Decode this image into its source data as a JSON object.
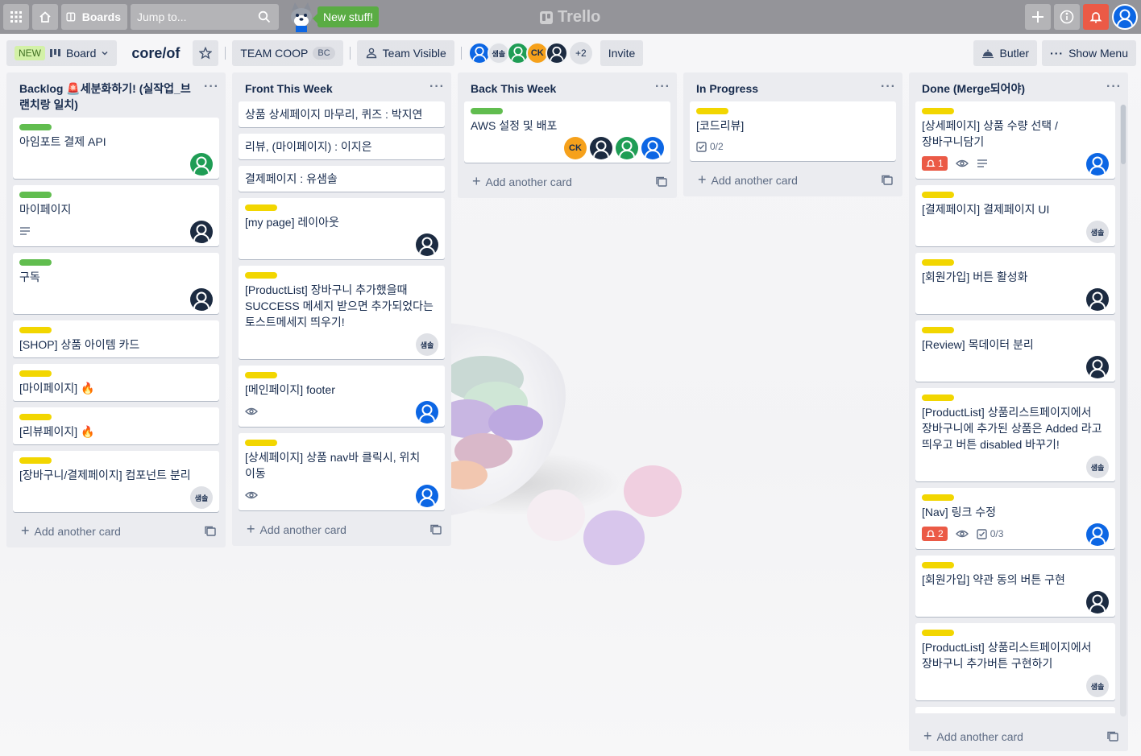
{
  "topbar": {
    "boards_label": "Boards",
    "search_placeholder": "Jump to...",
    "new_stuff_label": "New stuff!",
    "logo_text": "Trello"
  },
  "header": {
    "new_badge": "NEW",
    "view_label": "Board",
    "board_title": "core/of",
    "team_label": "TEAM COOP",
    "team_badge": "BC",
    "visibility_label": "Team Visible",
    "members": [
      "",
      "샘솔",
      "",
      "CK",
      ""
    ],
    "more_members": "+2",
    "invite_label": "Invite",
    "butler_label": "Butler",
    "show_menu_label": "Show Menu"
  },
  "add_card_label": "Add another card",
  "lists": [
    {
      "title": "Backlog 🚨세분화하기! (실작업_브랜치랑 일치)",
      "cards": [
        {
          "label": "green",
          "text": "아임포트 결제 API",
          "members": [
            "green"
          ]
        },
        {
          "label": "green",
          "text": "마이페이지",
          "description": true,
          "members": [
            "dark"
          ]
        },
        {
          "label": "green",
          "text": "구독",
          "members": [
            "dark"
          ]
        },
        {
          "label": "yellow",
          "text": "[SHOP] 상품 아이템 카드"
        },
        {
          "label": "yellow",
          "text": "[마이페이지] 🔥"
        },
        {
          "label": "yellow",
          "text": "[리뷰페이지] 🔥"
        },
        {
          "label": "yellow",
          "text": "[장바구니/결제페이지] 컴포넌트 분리",
          "members": [
            "gray:샘솔"
          ]
        }
      ]
    },
    {
      "title": "Front This Week",
      "cards": [
        {
          "text": "상품 상세페이지 마무리, 퀴즈 : 박지연"
        },
        {
          "text": "리뷰, (마이페이지) : 이지은"
        },
        {
          "text": "결제페이지 : 유샘솔"
        },
        {
          "label": "yellow",
          "text": "[my page] 레이아웃",
          "members": [
            "dark"
          ]
        },
        {
          "label": "yellow",
          "text": "[ProductList] 장바구니 추가했을때 SUCCESS 메세지 받으면 추가되었다는 토스트메세지 띄우기!",
          "members": [
            "gray:샘솔"
          ]
        },
        {
          "label": "yellow",
          "text": "[메인페이지] footer",
          "watch": true,
          "members": [
            "blue"
          ]
        },
        {
          "label": "yellow",
          "text": "[상세페이지] 상품 nav바 클릭시, 위치 이동",
          "watch": true,
          "members": [
            "blue"
          ]
        }
      ]
    },
    {
      "title": "Back This Week",
      "cards": [
        {
          "label": "green",
          "text": "AWS 설정 및 배포",
          "members": [
            "orange:CK",
            "dark",
            "green",
            "blue"
          ]
        }
      ]
    },
    {
      "title": "In Progress",
      "cards": [
        {
          "label": "yellow",
          "text": "[코드리뷰]",
          "checklist": "0/2"
        }
      ]
    },
    {
      "title": "Done (Merge되어야)",
      "cards": [
        {
          "label": "yellow",
          "text": "[상세페이지] 상품 수량 선택 / 장바구니담기",
          "notif": "1",
          "watch": true,
          "description": true,
          "members": [
            "blue"
          ]
        },
        {
          "label": "yellow",
          "text": "[결제페이지] 결제페이지 UI",
          "members": [
            "gray:샘솔"
          ]
        },
        {
          "label": "yellow",
          "text": "[회원가입] 버튼 활성화",
          "members": [
            "dark"
          ]
        },
        {
          "label": "yellow",
          "text": "[Review] 목데이터 분리",
          "members": [
            "dark"
          ]
        },
        {
          "label": "yellow",
          "text": "[ProductList] 상품리스트페이지에서 장바구니에 추가된 상품은 Added 라고 띄우고 버튼 disabled 바꾸기!",
          "members": [
            "gray:샘솔"
          ]
        },
        {
          "label": "yellow",
          "text": "[Nav] 링크 수정",
          "notif": "2",
          "watch": true,
          "checklist": "0/3",
          "members": [
            "blue"
          ]
        },
        {
          "label": "yellow",
          "text": "[회원가입] 약관 동의 버튼 구현",
          "members": [
            "dark"
          ]
        },
        {
          "label": "yellow",
          "text": "[ProductList] 상품리스트페이지에서 장바구니 추가버튼 구현하기",
          "members": [
            "gray:샘솔"
          ]
        },
        {
          "label": "yellow",
          "text": ""
        }
      ]
    }
  ],
  "colors": {
    "green_label": "#61bd4f",
    "yellow_label": "#f2d600",
    "notification": "#eb5a46",
    "new_stuff": "#5aac44"
  }
}
